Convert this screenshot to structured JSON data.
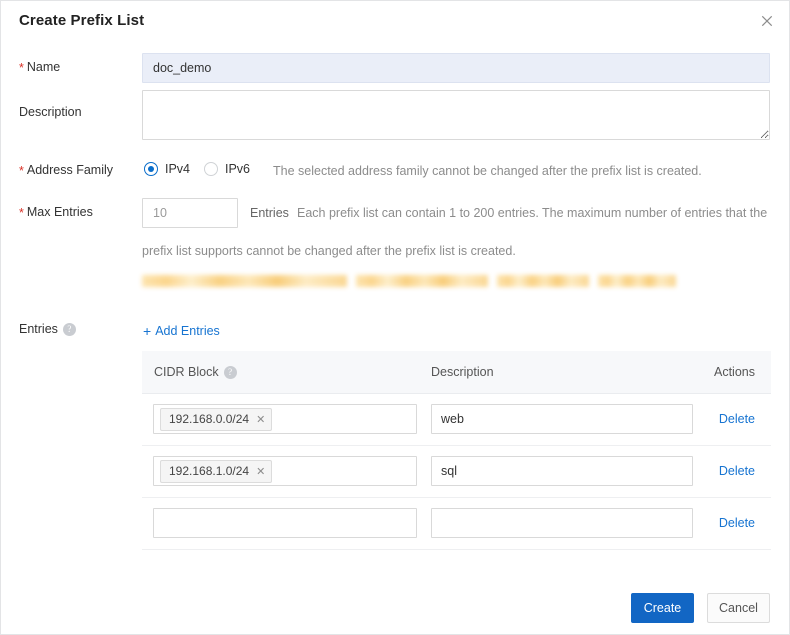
{
  "dialog": {
    "title": "Create Prefix List",
    "close_icon": "close-icon"
  },
  "fields": {
    "name": {
      "label": "Name",
      "required": true,
      "value": "doc_demo",
      "placeholder": ""
    },
    "description": {
      "label": "Description",
      "required": false,
      "value": "",
      "placeholder": ""
    },
    "address_family": {
      "label": "Address Family",
      "required": true,
      "options": [
        "IPv4",
        "IPv6"
      ],
      "selected": "IPv4",
      "hint": "The selected address family cannot be changed after the prefix list is created."
    },
    "max_entries": {
      "label": "Max Entries",
      "required": true,
      "value": "10",
      "unit": "Entries",
      "hint_line1": "Each prefix list can contain 1 to 200 entries. The maximum number of entries that the",
      "hint_line2": "prefix list supports cannot be changed after the prefix list is created."
    },
    "redacted": {
      "label": "redacted-text",
      "segments": [
        205,
        132,
        92,
        78
      ]
    },
    "entries": {
      "label": "Entries",
      "help_icon": "help-icon",
      "add_label": "Add Entries",
      "add_icon": "plus-icon"
    }
  },
  "entries_table": {
    "columns": [
      "CIDR Block",
      "Description",
      "Actions"
    ],
    "cidr_help_icon": "help-icon",
    "action_label": "Delete",
    "chip_remove_icon": "close-icon",
    "rows": [
      {
        "cidr": "192.168.0.0/24",
        "description": "web",
        "action": "Delete"
      },
      {
        "cidr": "192.168.1.0/24",
        "description": "sql",
        "action": "Delete"
      },
      {
        "cidr": "",
        "description": "",
        "action": "Delete"
      }
    ]
  },
  "footer": {
    "primary_label": "Create",
    "secondary_label": "Cancel"
  },
  "colors": {
    "accent": "#1266c4",
    "link": "#1774d1",
    "required": "#d93026",
    "redact": "#f9cf7d"
  }
}
